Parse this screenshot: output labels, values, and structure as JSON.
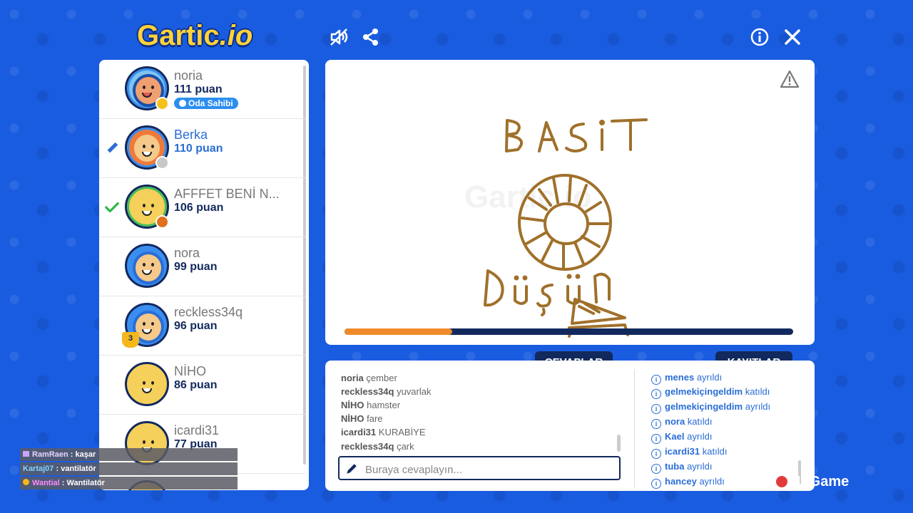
{
  "header": {
    "logo_main": "Gartic",
    "logo_suffix": ".io",
    "icons": [
      "mute-icon",
      "share-icon",
      "info-icon",
      "close-icon"
    ]
  },
  "players": [
    {
      "name": "noria",
      "score": "111 puan",
      "badge": "Oda Sahibi",
      "state": "owner"
    },
    {
      "name": "Berka",
      "score": "110 puan",
      "state": "drawing"
    },
    {
      "name": "AFFFET BENİ N...",
      "score": "106 puan",
      "state": "guessed"
    },
    {
      "name": "nora",
      "score": "99 puan"
    },
    {
      "name": "reckless34q",
      "score": "96 puan",
      "rank": "3"
    },
    {
      "name": "NİHO",
      "score": "86 puan"
    },
    {
      "name": "icardi31",
      "score": "77 puan"
    }
  ],
  "canvas": {
    "watermark": "Gartic.io",
    "drawing_words": [
      "BASIT",
      "DÜŞÜN"
    ],
    "timer_progress": 0.24
  },
  "tabs": {
    "answers": "CEVAPLAR",
    "logs": "KAYITLAR"
  },
  "answers": [
    {
      "user": "noria",
      "text": "çember"
    },
    {
      "user": "reckless34q",
      "text": "yuvarlak"
    },
    {
      "user": "NİHO",
      "text": "hamster"
    },
    {
      "user": "NİHO",
      "text": "fare"
    },
    {
      "user": "icardi31",
      "text": "KURABİYE"
    },
    {
      "user": "reckless34q",
      "text": "çark"
    }
  ],
  "logs": [
    {
      "user": "menes",
      "action": "ayrıldı"
    },
    {
      "user": "gelmekiçingeldim",
      "action": "katıldı"
    },
    {
      "user": "gelmekiçingeldim",
      "action": "ayrıldı"
    },
    {
      "user": "nora",
      "action": "katıldı"
    },
    {
      "user": "Kael",
      "action": "ayrıldı"
    },
    {
      "user": "icardi31",
      "action": "katıldı"
    },
    {
      "user": "tuba",
      "action": "ayrıldı"
    },
    {
      "user": "hancey",
      "action": "ayrıldı"
    }
  ],
  "input": {
    "placeholder": "Buraya cevaplayın..."
  },
  "stream_chat": [
    {
      "user": "RamRaen",
      "msg": "kaşar"
    },
    {
      "user": "Kartaj07",
      "msg": "vantilatör"
    },
    {
      "user": "Wantial",
      "msg": "Wantilatör"
    }
  ],
  "stream_watermark": "NoGame",
  "colors": {
    "background": "#1a5ce0",
    "navy": "#12295e",
    "accent_blue": "#2a6dd6",
    "timer": "#f08a2a",
    "drawing_brown": "#a0702a"
  }
}
